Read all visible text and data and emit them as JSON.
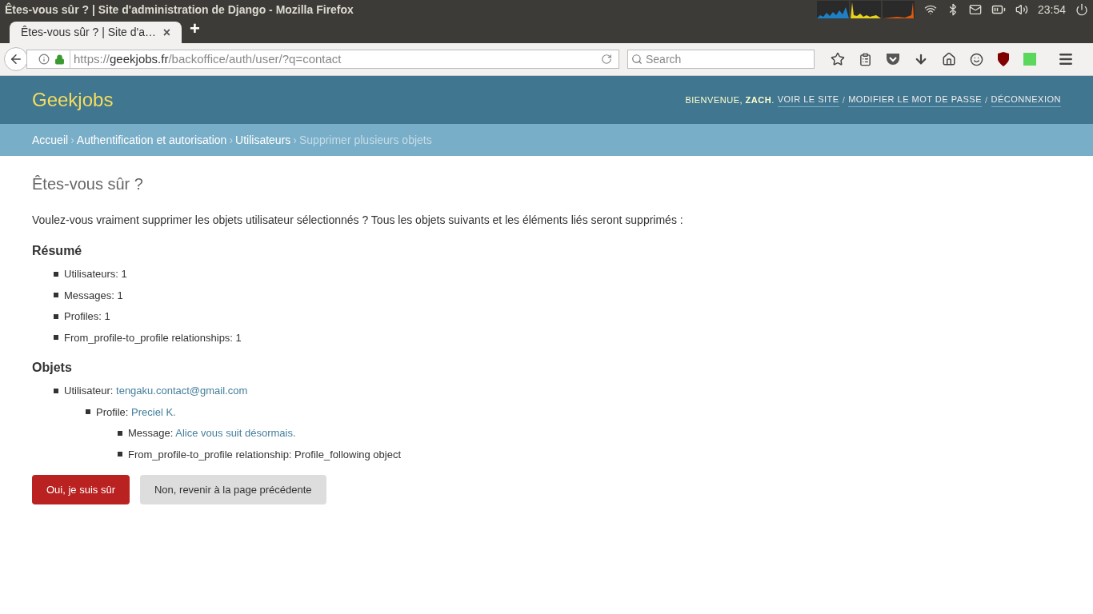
{
  "system_bar": {
    "window_title": "Êtes-vous sûr ? | Site d'administration de Django - Mozilla Firefox",
    "clock": "23:54"
  },
  "browser": {
    "tab": {
      "title": "Êtes-vous sûr ? | Site d'a…",
      "close": "×",
      "selected": true
    },
    "new_tab": "+",
    "url": {
      "scheme": "https://",
      "host": "geekjobs.fr",
      "path": "/backoffice/auth/user/?q=contact"
    },
    "search": {
      "placeholder": "Search"
    }
  },
  "header": {
    "site_name": "Geekjobs",
    "welcome": "BIENVENUE, **ZACH**.",
    "links": [
      "VOIR LE SITE",
      "MODIFIER LE MOT DE PASSE",
      "DÉCONNEXION"
    ],
    "separators": [
      "/",
      "/"
    ]
  },
  "breadcrumb_separators": [
    "›",
    "›",
    "›"
  ],
  "breadcrumbs": [
    {
      "label": "Accueil",
      "current": false
    },
    {
      "label": "Authentification et autorisation",
      "current": false
    },
    {
      "label": "Utilisateurs",
      "current": false
    },
    {
      "label": "Supprimer plusieurs objets",
      "current": true
    }
  ],
  "title": "Êtes-vous sûr ?",
  "question": "Voulez-vous vraiment supprimer les objets utilisateur sélectionnés ? Tous les objets suivants et les éléments liés seront supprimés :",
  "summary": {
    "heading": "Résumé",
    "items": [
      "Utilisateurs: 1",
      "Messages: 1",
      "Profiles: 1",
      "From_profile-to_profile relationships: 1"
    ]
  },
  "objects": {
    "heading": "Objets",
    "items": [
      {
        "label": "Utilisateur:",
        "link": "tengaku.contact@gmail.com",
        "children": [
          {
            "label": "Profile:",
            "link": "Preciel K.",
            "children": [
              {
                "label": "Message:",
                "link": "Alice vous suit désormais."
              },
              {
                "label": "From_profile-to_profile relationship: Profile_following object"
              }
            ]
          }
        ]
      }
    ]
  },
  "buttons": [
    {
      "label": "Oui, je suis sûr",
      "kind": "danger"
    },
    {
      "label": "Non, revenir à la page précédente",
      "kind": "cancel"
    }
  ]
}
